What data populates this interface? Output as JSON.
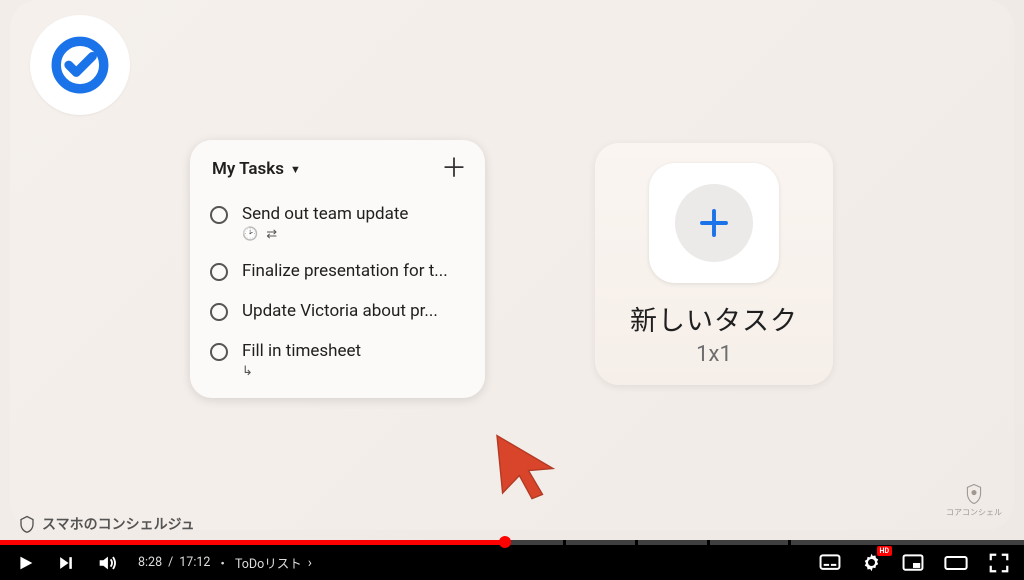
{
  "logo": {
    "name": "tasks-logo-icon",
    "accent": "#1a73e8"
  },
  "tasksCard": {
    "title": "My Tasks",
    "items": [
      {
        "text": "Send out team update",
        "hasTime": true,
        "hasRepeat": true
      },
      {
        "text": "Finalize presentation for t...",
        "hasTime": false,
        "hasRepeat": false
      },
      {
        "text": "Update Victoria about pr...",
        "hasTime": false,
        "hasRepeat": false
      },
      {
        "text": "Fill in timesheet",
        "hasSub": true
      }
    ]
  },
  "newTask": {
    "label": "新しいタスク",
    "size": "1x1"
  },
  "watermark": {
    "text": "コアコンシェル"
  },
  "player": {
    "current": "8:28",
    "duration": "17:12",
    "chapter": "ToDoリスト",
    "hd": "HD"
  },
  "channel": {
    "name": "スマホのコンシェルジュ"
  },
  "progress": {
    "percent": 49.3,
    "ticks": [
      13,
      20,
      27,
      34,
      41,
      48,
      55,
      62,
      69,
      77
    ]
  }
}
